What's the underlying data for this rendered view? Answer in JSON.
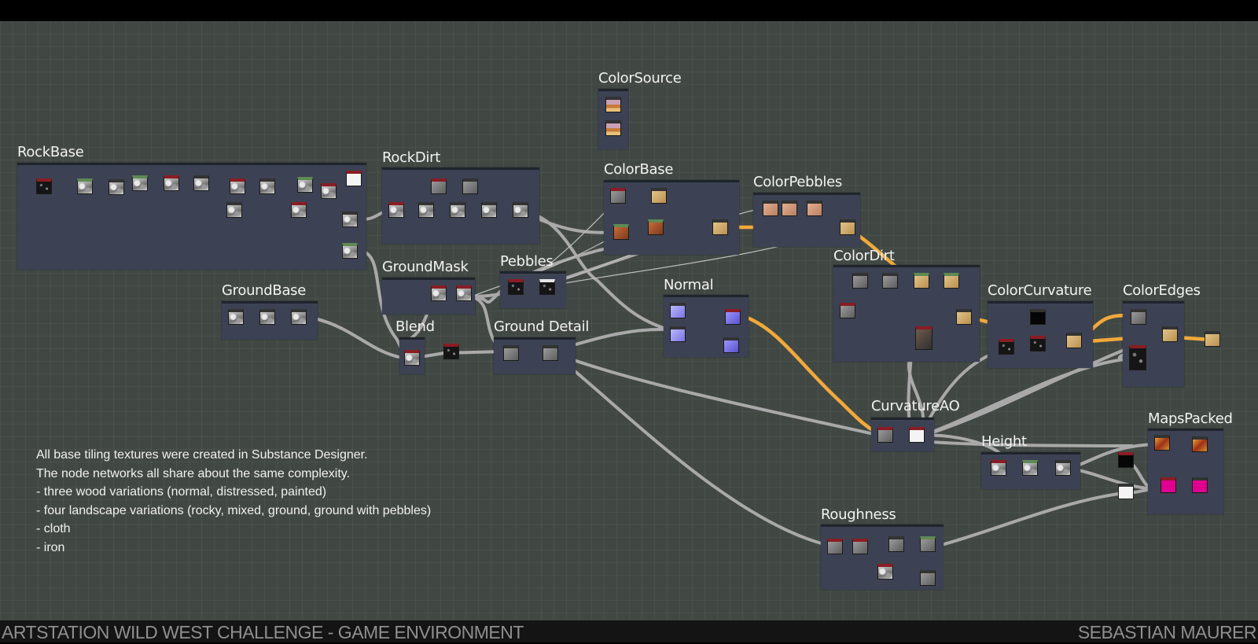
{
  "frames": {
    "colorsource": "ColorSource",
    "rockbase": "RockBase",
    "rockdirt": "RockDirt",
    "colorbase": "ColorBase",
    "colorpebbles": "ColorPebbles",
    "colordirt": "ColorDirt",
    "groundmask": "GroundMask",
    "pebbles": "Pebbles",
    "normal": "Normal",
    "groundbase": "GroundBase",
    "blend": "Blend",
    "grounddetail": "Ground Detail",
    "colorcurvature": "ColorCurvature",
    "coloredges": "ColorEdges",
    "curvatureao": "CurvatureAO",
    "mapspacked": "MapsPacked",
    "height": "Height",
    "roughness": "Roughness"
  },
  "description": [
    "All base tiling textures were created in Substance Designer.",
    "The node networks all share about the same complexity.",
    "",
    "- three wood variations (normal, distressed, painted)",
    "- four landscape variations (rocky, mixed, ground, ground with pebbles)",
    "- cloth",
    "- iron"
  ],
  "footer": {
    "left": "ARTSTATION WILD WEST CHALLENGE - GAME ENVIRONMENT",
    "right": "SEBASTIAN MAURER"
  },
  "colors": {
    "canvas": "#414844",
    "frame": "#3c4253",
    "wire_grey": "#a9a9a9",
    "wire_orange": "#f2a93b",
    "footer": "#141414"
  }
}
